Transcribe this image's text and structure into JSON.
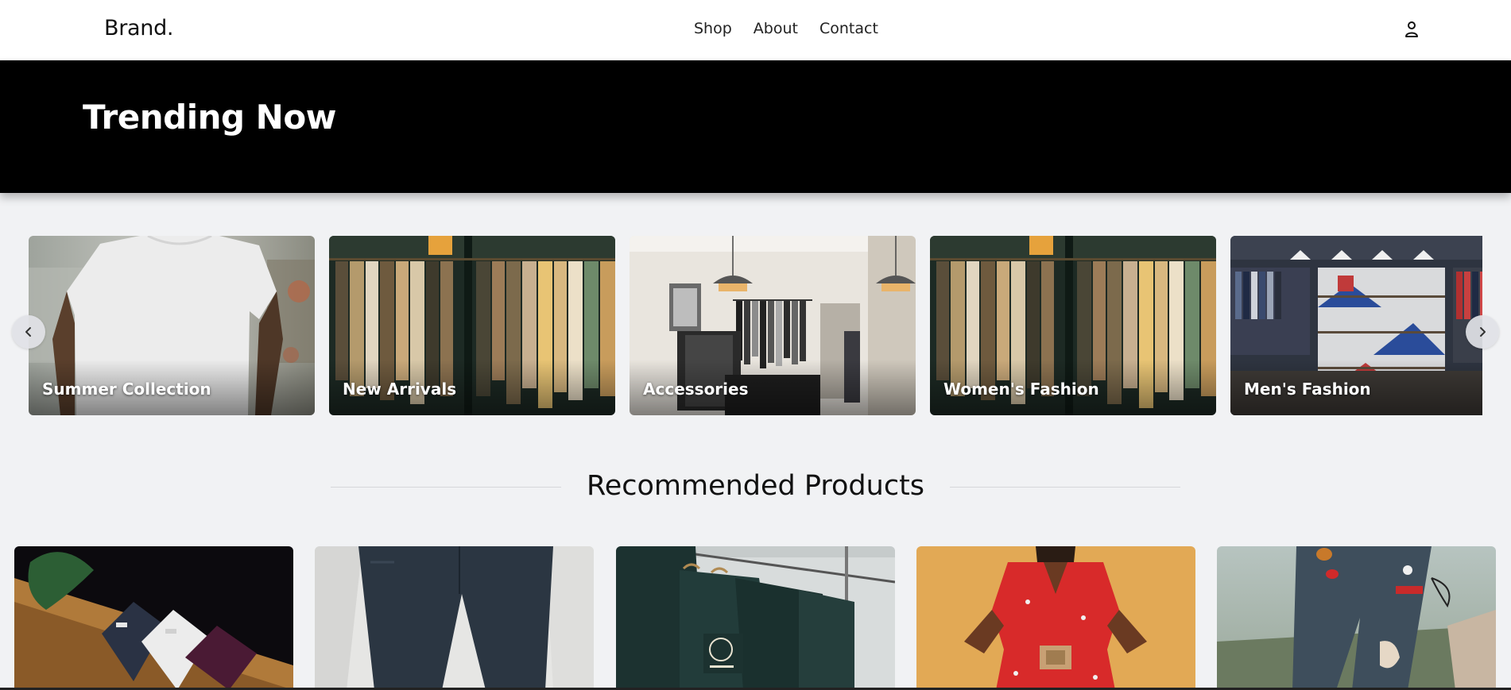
{
  "header": {
    "brand": "Brand.",
    "nav": [
      "Shop",
      "About",
      "Contact"
    ],
    "user_icon": "user-icon"
  },
  "hero": {
    "title": "Trending Now",
    "background": "#000000"
  },
  "carousel": {
    "prev_icon": "chevron-left-icon",
    "next_icon": "chevron-right-icon",
    "categories": [
      {
        "label": "Summer Collection"
      },
      {
        "label": "New Arrivals"
      },
      {
        "label": "Accessories"
      },
      {
        "label": "Women's Fashion"
      },
      {
        "label": "Men's Fashion"
      }
    ]
  },
  "recommended": {
    "title": "Recommended Products",
    "products": [
      {
        "image": "dress-shirts-on-table"
      },
      {
        "image": "dark-jeans"
      },
      {
        "image": "t-shirts-on-rack"
      },
      {
        "image": "red-floral-dress"
      },
      {
        "image": "patched-ripped-jeans"
      }
    ]
  }
}
